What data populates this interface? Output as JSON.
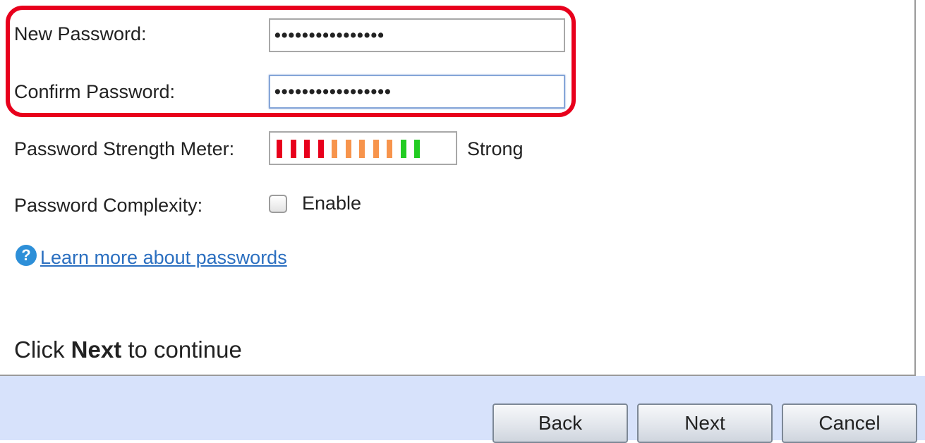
{
  "form": {
    "new_password": {
      "label": "New Password:",
      "value": "••••••••••••••••"
    },
    "confirm_password": {
      "label": "Confirm Password:",
      "value": "•••••••••••••••••"
    },
    "strength_meter": {
      "label": "Password Strength Meter:",
      "result": "Strong",
      "bar_colors": [
        "#e8001c",
        "#e8001c",
        "#e8001c",
        "#e8001c",
        "#f7944c",
        "#f7944c",
        "#f7944c",
        "#f7944c",
        "#f7944c",
        "#22cc22",
        "#22cc22"
      ]
    },
    "complexity": {
      "label": "Password Complexity:",
      "checkbox_label": "Enable",
      "checked": false
    },
    "help_icon": "question-icon",
    "help_icon_glyph": "?",
    "learn_more_link": "Learn more about passwords"
  },
  "instruction": {
    "prefix": "Click ",
    "bold": "Next",
    "suffix": " to continue"
  },
  "buttons": {
    "back": "Back",
    "next": "Next",
    "cancel": "Cancel"
  },
  "highlight_color": "#e8001c"
}
